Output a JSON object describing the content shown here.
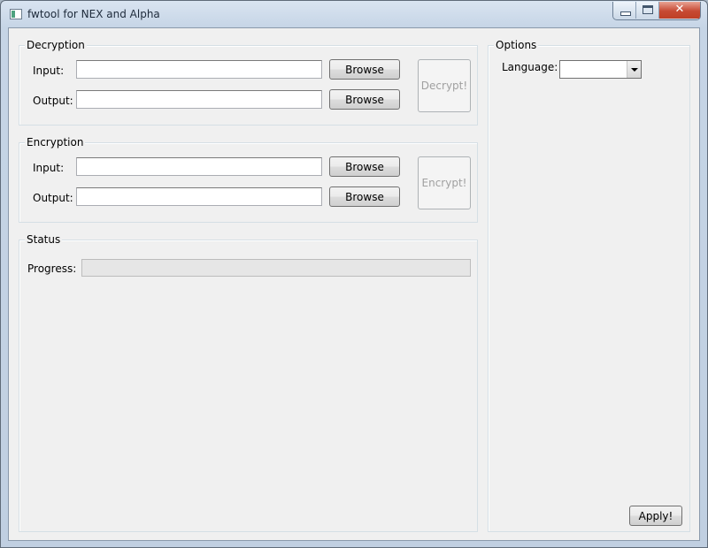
{
  "window": {
    "title": "fwtool for NEX and Alpha"
  },
  "decryption": {
    "title": "Decryption",
    "input_label": "Input:",
    "input_value": "",
    "output_label": "Output:",
    "output_value": "",
    "browse_input_label": "Browse",
    "browse_output_label": "Browse",
    "action_label": "Decrypt!"
  },
  "encryption": {
    "title": "Encryption",
    "input_label": "Input:",
    "input_value": "",
    "output_label": "Output:",
    "output_value": "",
    "browse_input_label": "Browse",
    "browse_output_label": "Browse",
    "action_label": "Encrypt!"
  },
  "status": {
    "title": "Status",
    "progress_label": "Progress:",
    "progress_value": 0
  },
  "options": {
    "title": "Options",
    "language_label": "Language:",
    "language_value": "",
    "apply_label": "Apply!"
  }
}
